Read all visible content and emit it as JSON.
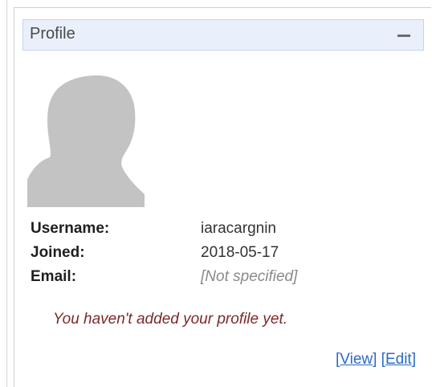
{
  "panel": {
    "title": "Profile",
    "collapse_icon": "minus-icon"
  },
  "avatar": {
    "icon": "default-avatar-silhouette"
  },
  "info": {
    "username_label": "Username:",
    "username_value": "iaracargnin",
    "joined_label": "Joined:",
    "joined_value": "2018-05-17",
    "email_label": "Email:",
    "email_value": "[Not specified]"
  },
  "notice": "You haven't added your profile yet.",
  "links": {
    "open_bracket_1": "[",
    "view_label": "View",
    "close_bracket_1": "]",
    "open_bracket_2": " [",
    "edit_label": "Edit",
    "close_bracket_2": "]"
  },
  "colors": {
    "header_bg": "#e9f0fb",
    "notice": "#7b2a2a",
    "link": "#2a6ac4"
  }
}
